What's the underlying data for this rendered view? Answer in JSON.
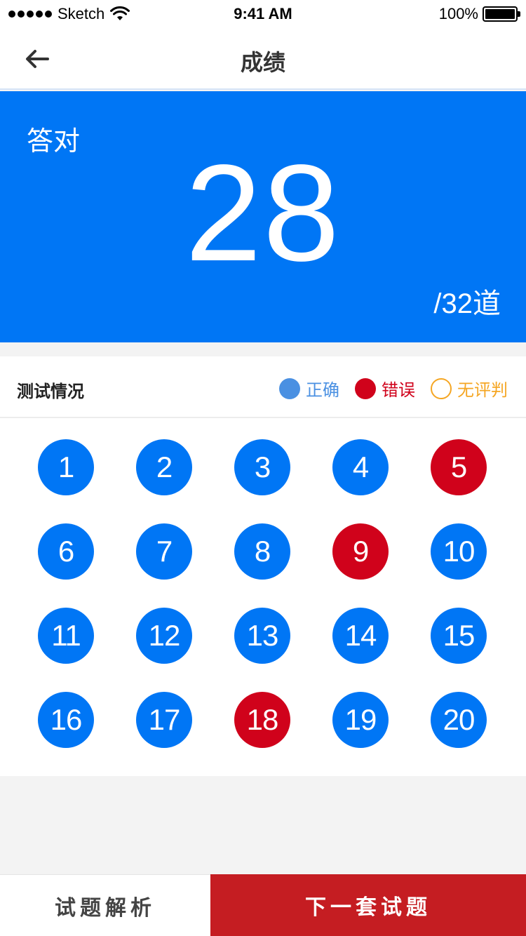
{
  "status_bar": {
    "carrier": "Sketch",
    "time": "9:41 AM",
    "battery": "100%"
  },
  "nav": {
    "title": "成绩",
    "back_icon": "arrow-left-icon"
  },
  "score": {
    "label": "答对",
    "value": "28",
    "total": "/32道"
  },
  "section": {
    "title": "测试情况",
    "legend": [
      {
        "label": "正确",
        "color": "#4a90e2",
        "style": "filled"
      },
      {
        "label": "错误",
        "color": "#d0021b",
        "style": "filled"
      },
      {
        "label": "无评判",
        "color": "#f5a623",
        "style": "outline"
      }
    ]
  },
  "colors": {
    "correct": "#0076f5",
    "wrong": "#d0021b",
    "accent": "#0076f5",
    "next_button": "#c51d22"
  },
  "questions": [
    {
      "num": "1",
      "status": "correct"
    },
    {
      "num": "2",
      "status": "correct"
    },
    {
      "num": "3",
      "status": "correct"
    },
    {
      "num": "4",
      "status": "correct"
    },
    {
      "num": "5",
      "status": "wrong"
    },
    {
      "num": "6",
      "status": "correct"
    },
    {
      "num": "7",
      "status": "correct"
    },
    {
      "num": "8",
      "status": "correct"
    },
    {
      "num": "9",
      "status": "wrong"
    },
    {
      "num": "10",
      "status": "correct"
    },
    {
      "num": "11",
      "status": "correct"
    },
    {
      "num": "12",
      "status": "correct"
    },
    {
      "num": "13",
      "status": "correct"
    },
    {
      "num": "14",
      "status": "correct"
    },
    {
      "num": "15",
      "status": "correct"
    },
    {
      "num": "16",
      "status": "correct"
    },
    {
      "num": "17",
      "status": "correct"
    },
    {
      "num": "18",
      "status": "wrong"
    },
    {
      "num": "19",
      "status": "correct"
    },
    {
      "num": "20",
      "status": "correct"
    }
  ],
  "buttons": {
    "analysis": "试题解析",
    "next": "下一套试题"
  }
}
